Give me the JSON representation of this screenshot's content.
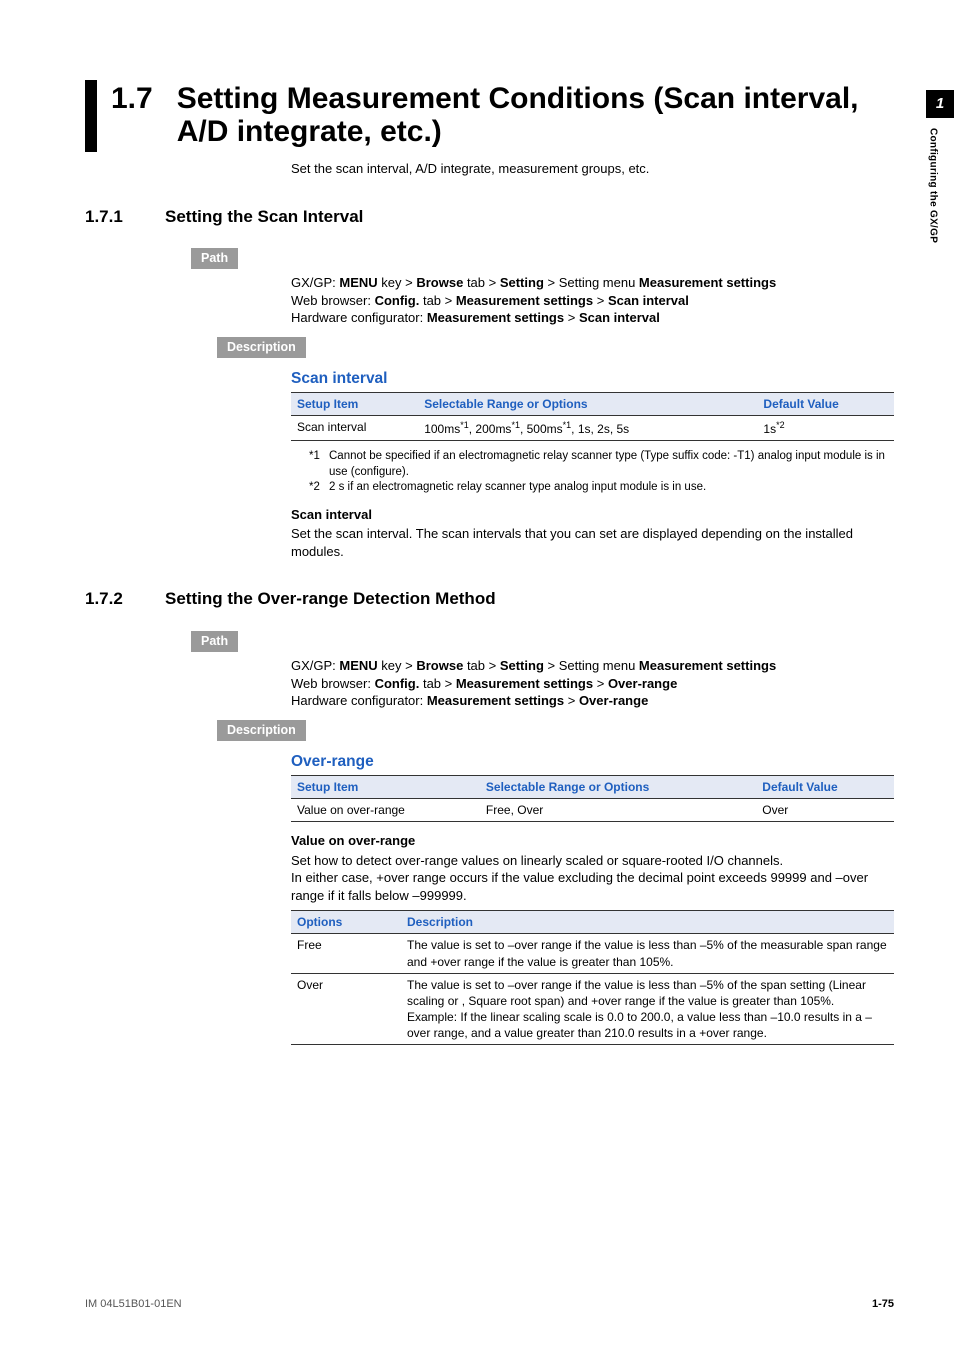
{
  "side": {
    "chapter_num": "1",
    "chapter_label": "Configuring the GX/GP"
  },
  "title": {
    "num": "1.7",
    "text": "Setting Measurement Conditions (Scan interval, A/D integrate, etc.)"
  },
  "intro": "Set the scan interval, A/D integrate, measurement groups, etc.",
  "labels": {
    "path": "Path",
    "description": "Description"
  },
  "s1": {
    "num": "1.7.1",
    "text": "Setting the Scan Interval",
    "path": {
      "l1a": "GX/GP: ",
      "l1b": "MENU",
      "l1c": " key > ",
      "l1d": "Browse",
      "l1e": " tab > ",
      "l1f": "Setting",
      "l1g": " > Setting menu ",
      "l1h": "Measurement settings",
      "l2a": "Web browser: ",
      "l2b": "Config.",
      "l2c": " tab > ",
      "l2d": "Measurement settings",
      "l2e": " > ",
      "l2f": "Scan interval",
      "l3a": "Hardware configurator: ",
      "l3b": "Measurement settings",
      "l3c": " > ",
      "l3d": "Scan interval"
    },
    "blue": "Scan interval",
    "th": {
      "a": "Setup Item",
      "b": "Selectable Range or Options",
      "c": "Default Value"
    },
    "row": {
      "a": "Scan interval",
      "b_pre": "100ms",
      "b_mid1": ", 200ms",
      "b_mid2": ", 500ms",
      "b_post": ", 1s, 2s, 5s",
      "sup": "*1",
      "c": "1s",
      "c_sup": "*2"
    },
    "fn1": "Cannot be specified if an electromagnetic relay scanner type (Type suffix code: -T1) analog input module is in use (configure).",
    "fn2": "2 s if an electromagnetic relay scanner type analog input module is in use.",
    "m1": "*1",
    "m2": "*2",
    "sub": "Scan interval",
    "subtext": "Set the scan interval. The scan intervals that you can set are displayed depending on the installed modules."
  },
  "s2": {
    "num": "1.7.2",
    "text": "Setting the Over-range Detection Method",
    "path": {
      "l1a": "GX/GP: ",
      "l1b": "MENU",
      "l1c": " key > ",
      "l1d": "Browse",
      "l1e": " tab > ",
      "l1f": "Setting",
      "l1g": " > Setting menu ",
      "l1h": "Measurement settings",
      "l2a": "Web browser: ",
      "l2b": "Config.",
      "l2c": " tab > ",
      "l2d": "Measurement settings",
      "l2e": " > ",
      "l2f": "Over-range",
      "l3a": "Hardware configurator: ",
      "l3b": "Measurement settings",
      "l3c": " > ",
      "l3d": "Over-range"
    },
    "blue": "Over-range",
    "th": {
      "a": "Setup Item",
      "b": "Selectable Range or Options",
      "c": "Default Value"
    },
    "row": {
      "a": "Value on over-range",
      "b": "Free, Over",
      "c": "Over"
    },
    "sub": "Value on over-range",
    "p1": "Set how to detect over-range values on linearly scaled or square-rooted I/O channels.",
    "p2": "In either case, +over range occurs if the value excluding the decimal point exceeds 99999 and –over range if it falls below –999999.",
    "oh": {
      "a": "Options",
      "b": "Description"
    },
    "o1": {
      "a": "Free",
      "b": "The value is set to –over range if the value is less than –5% of the measurable span range and +over range if the value is greater than 105%."
    },
    "o2": {
      "a": "Over",
      "b1": "The value is set to –over range if the value is less than –5% of the span setting (Linear scaling or , Square root span) and +over range if the value is greater than 105%.",
      "b2": "Example: If the linear scaling scale is 0.0 to 200.0, a value less than –10.0 results in a –over range, and a value greater than 210.0 results in a +over range."
    }
  },
  "footer": {
    "left": "IM 04L51B01-01EN",
    "right": "1-75"
  }
}
